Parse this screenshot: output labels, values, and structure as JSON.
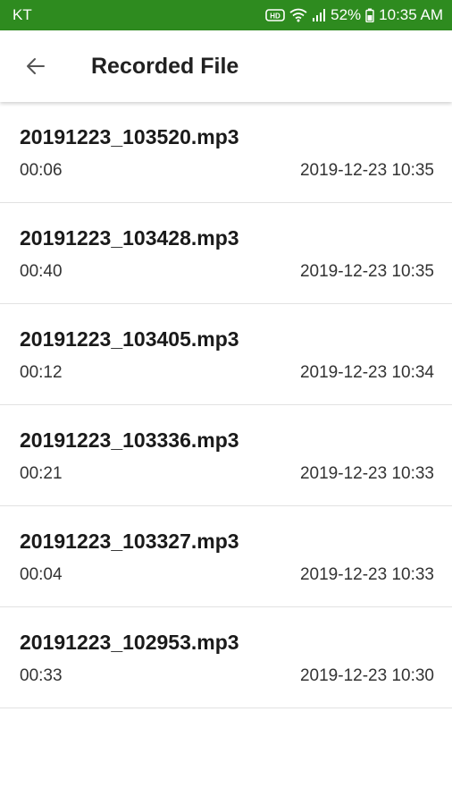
{
  "status_bar": {
    "carrier": "KT",
    "hd_badge": "HD",
    "battery": "52%",
    "time": "10:35 AM",
    "background_color": "#2e8b1f"
  },
  "app_bar": {
    "back_icon": "arrow-back-icon",
    "title": "Recorded File"
  },
  "files": [
    {
      "name": "20191223_103520.mp3",
      "duration": "00:06",
      "date": "2019-12-23 10:35"
    },
    {
      "name": "20191223_103428.mp3",
      "duration": "00:40",
      "date": "2019-12-23 10:35"
    },
    {
      "name": "20191223_103405.mp3",
      "duration": "00:12",
      "date": "2019-12-23 10:34"
    },
    {
      "name": "20191223_103336.mp3",
      "duration": "00:21",
      "date": "2019-12-23 10:33"
    },
    {
      "name": "20191223_103327.mp3",
      "duration": "00:04",
      "date": "2019-12-23 10:33"
    },
    {
      "name": "20191223_102953.mp3",
      "duration": "00:33",
      "date": "2019-12-23 10:30"
    }
  ]
}
